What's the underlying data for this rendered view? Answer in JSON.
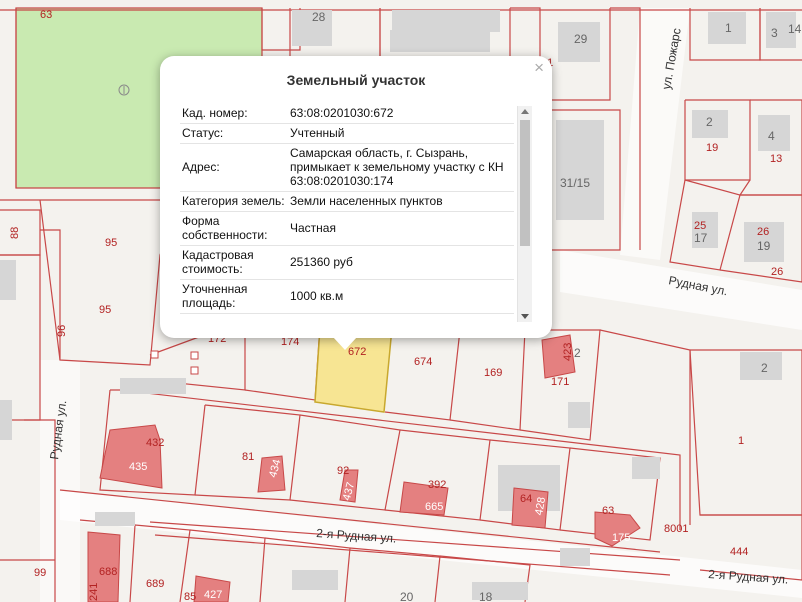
{
  "popup": {
    "title": "Земельный участок",
    "rows": [
      {
        "label": "Кад. номер:",
        "value": "63:08:0201030:672"
      },
      {
        "label": "Статус:",
        "value": "Учтенный"
      },
      {
        "label": "Адрес:",
        "value": "Самарская область, г. Сызрань, примыкает к земельному участку с КН 63:08:0201030:174"
      },
      {
        "label": "Категория земель:",
        "value": "Земли населенных пунктов"
      },
      {
        "label": "Форма собственности:",
        "value": "Частная"
      },
      {
        "label": "Кадастровая стоимость:",
        "value": "251360 руб"
      },
      {
        "label": "Уточненная площадь:",
        "value": "1000 кв.м"
      }
    ],
    "close_symbol": "×"
  },
  "streets": {
    "rudnaya_left": "Рудная ул.",
    "rudnaya_right": "Рудная ул.",
    "rudnaya2_center": "2-я Рудная ул.",
    "rudnaya2_right": "2-я Рудная ул.",
    "pozharsky": "ул. Пожарс"
  },
  "labels": {
    "n63": "63",
    "n28": "28",
    "n29": "29",
    "n21": "21",
    "n1": "1",
    "n3": "3",
    "n14": "14",
    "n2a": "2",
    "n4": "4",
    "n19a": "19",
    "n13": "13",
    "n31_15": "31/15",
    "n25": "25",
    "n17": "17",
    "n26a": "26",
    "n19b": "19",
    "n26b": "26",
    "n88": "88",
    "n95a": "95",
    "n95b": "95",
    "n96": "96",
    "n172": "172",
    "n174": "174",
    "n672": "672",
    "n674": "674",
    "n169": "169",
    "n423": "423",
    "n2b": "2",
    "n171": "171",
    "n2c": "2",
    "n1b": "1",
    "n432": "432",
    "n435": "435",
    "n81": "81",
    "n434": "434",
    "n92": "92",
    "n437": "437",
    "n392": "392",
    "n665": "665",
    "n64": "64",
    "n428": "428",
    "n63b": "63",
    "n175": "175",
    "n8001": "8001",
    "n444": "444",
    "n99": "99",
    "n688": "688",
    "n241": "241",
    "n689": "689",
    "n85": "85",
    "n427": "427",
    "n20": "20",
    "n18": "18"
  }
}
